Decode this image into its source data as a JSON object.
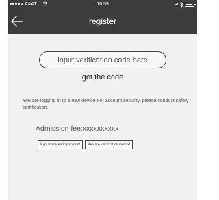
{
  "status_bar": {
    "carrier": "A&AT",
    "time": "16:59",
    "wifi_icon": "wifi-icon",
    "right_icons": [
      "location-arrow-icon",
      "bluetooth-icon",
      "battery-icon"
    ]
  },
  "nav": {
    "title": "register",
    "back_icon": "arrow-left-icon",
    "bar_color": "#3c3c3c"
  },
  "form": {
    "code_placeholder": "input verification code here",
    "get_code_label": "get the code"
  },
  "notice": {
    "text": "You are logging in to a new device.For account security, please conduct safety certification."
  },
  "fee": {
    "label": "Admission fee:",
    "value": "xxxxxxxxxx"
  },
  "actions": {
    "replace_account": "Replace receiving account",
    "replace_method": "Replace verification method"
  }
}
